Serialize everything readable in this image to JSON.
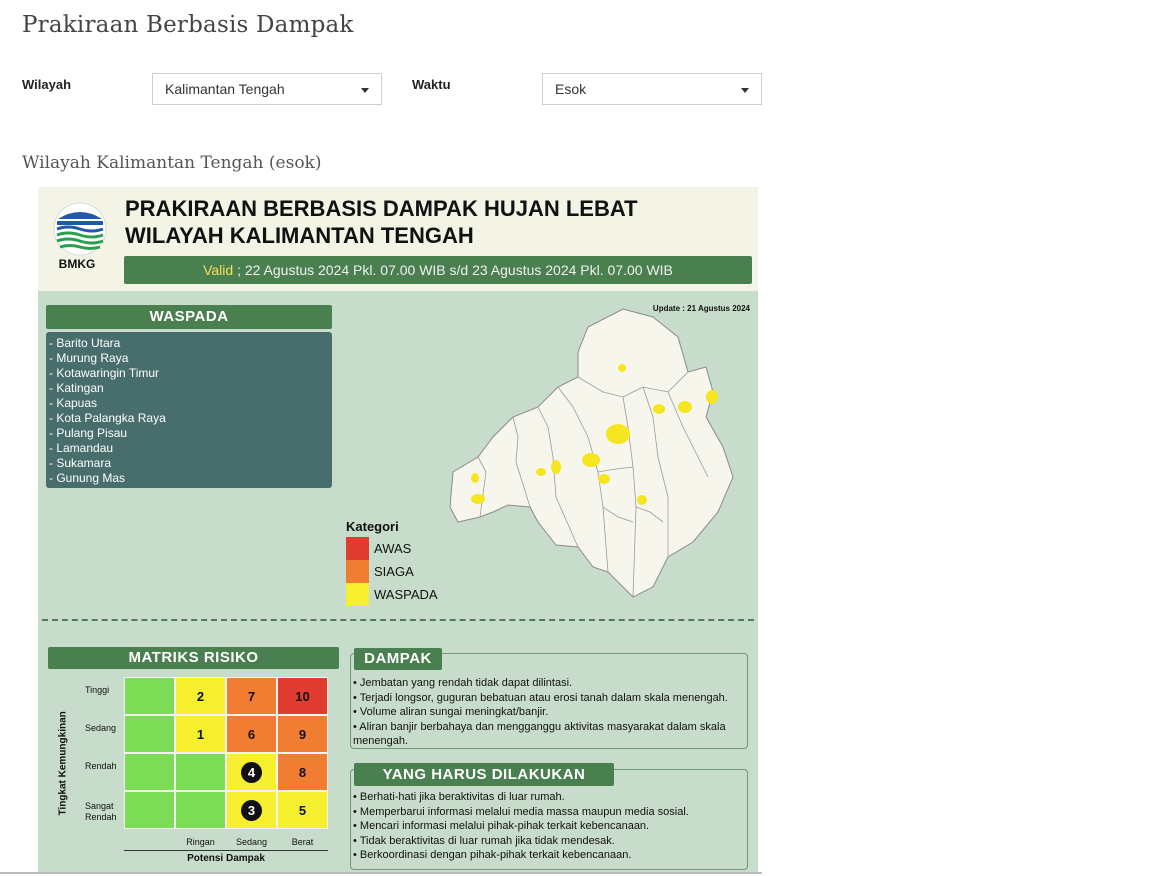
{
  "page": {
    "title": "Prakiraan Berbasis Dampak",
    "section_title": "Wilayah Kalimantan Tengah (esok)"
  },
  "filters": {
    "wilayah_label": "Wilayah",
    "wilayah_value": "Kalimantan Tengah",
    "waktu_label": "Waktu",
    "waktu_value": "Esok"
  },
  "infographic": {
    "logo_text": "BMKG",
    "title_line1": "PRAKIRAAN BERBASIS DAMPAK HUJAN LEBAT",
    "title_line2": "WILAYAH KALIMANTAN TENGAH",
    "valid_word": "Valid",
    "valid_text": " ; 22 Agustus 2024 Pkl. 07.00 WIB s/d 23 Agustus 2024 Pkl. 07.00 WIB",
    "update_text": "Update : 21 Agustus 2024",
    "waspada_header": "WASPADA",
    "waspada_list": [
      "- Barito Utara",
      "- Murung Raya",
      "- Kotawaringin Timur",
      "- Katingan",
      "- Kapuas",
      "- Kota Palangka Raya",
      "- Pulang Pisau",
      "- Lamandau",
      "- Sukamara",
      "- Gunung Mas"
    ],
    "legend": {
      "title": "Kategori",
      "items": [
        {
          "label": "AWAS",
          "color": "#e03c2f"
        },
        {
          "label": "SIAGA",
          "color": "#f07d32"
        },
        {
          "label": "WASPADA",
          "color": "#f5ef2e"
        }
      ]
    },
    "matrix": {
      "header": "MATRIKS RISIKO",
      "y_title": "Tingkat Kemungkinan",
      "x_title": "Potensi Dampak",
      "rows": [
        "Tinggi",
        "Sedang",
        "Rendah",
        "Sangat Rendah"
      ],
      "cols": [
        "Ringan",
        "Sedang",
        "Berat"
      ],
      "cells": [
        [
          {
            "text": "",
            "color": "#7cdc55"
          },
          {
            "text": "2",
            "color": "#f5ef2e"
          },
          {
            "text": "7",
            "color": "#f07d32"
          },
          {
            "text": "10",
            "color": "#e03c2f"
          }
        ],
        [
          {
            "text": "",
            "color": "#7cdc55"
          },
          {
            "text": "1",
            "color": "#f5ef2e"
          },
          {
            "text": "6",
            "color": "#f07d32"
          },
          {
            "text": "9",
            "color": "#f07d32"
          }
        ],
        [
          {
            "text": "",
            "color": "#7cdc55"
          },
          {
            "text": "",
            "color": "#7cdc55"
          },
          {
            "text": "4",
            "color": "#f5ef2e",
            "circled": true
          },
          {
            "text": "8",
            "color": "#f07d32"
          }
        ],
        [
          {
            "text": "",
            "color": "#7cdc55"
          },
          {
            "text": "",
            "color": "#7cdc55"
          },
          {
            "text": "3",
            "color": "#f5ef2e",
            "circled": true
          },
          {
            "text": "5",
            "color": "#f5ef2e"
          }
        ]
      ]
    },
    "dampak": {
      "header": "DAMPAK",
      "items": [
        "• Jembatan yang rendah tidak dapat dilintasi.",
        "• Terjadi longsor, guguran bebatuan atau erosi tanah dalam skala menengah.",
        "• Volume aliran sungai meningkat/banjir.",
        "• Aliran banjir berbahaya dan mengganggu aktivitas masyarakat dalam skala",
        "menengah."
      ]
    },
    "tindakan": {
      "header": "YANG HARUS DILAKUKAN",
      "items": [
        "• Berhati-hati jika beraktivitas di luar rumah.",
        "• Memperbarui informasi melalui media massa maupun media sosial.",
        "• Mencari informasi melalui pihak-pihak terkait kebencanaan.",
        "• Tidak beraktivitas di luar rumah jika tidak mendesak.",
        "• Berkoordinasi dengan pihak-pihak terkait kebencanaan."
      ]
    }
  }
}
